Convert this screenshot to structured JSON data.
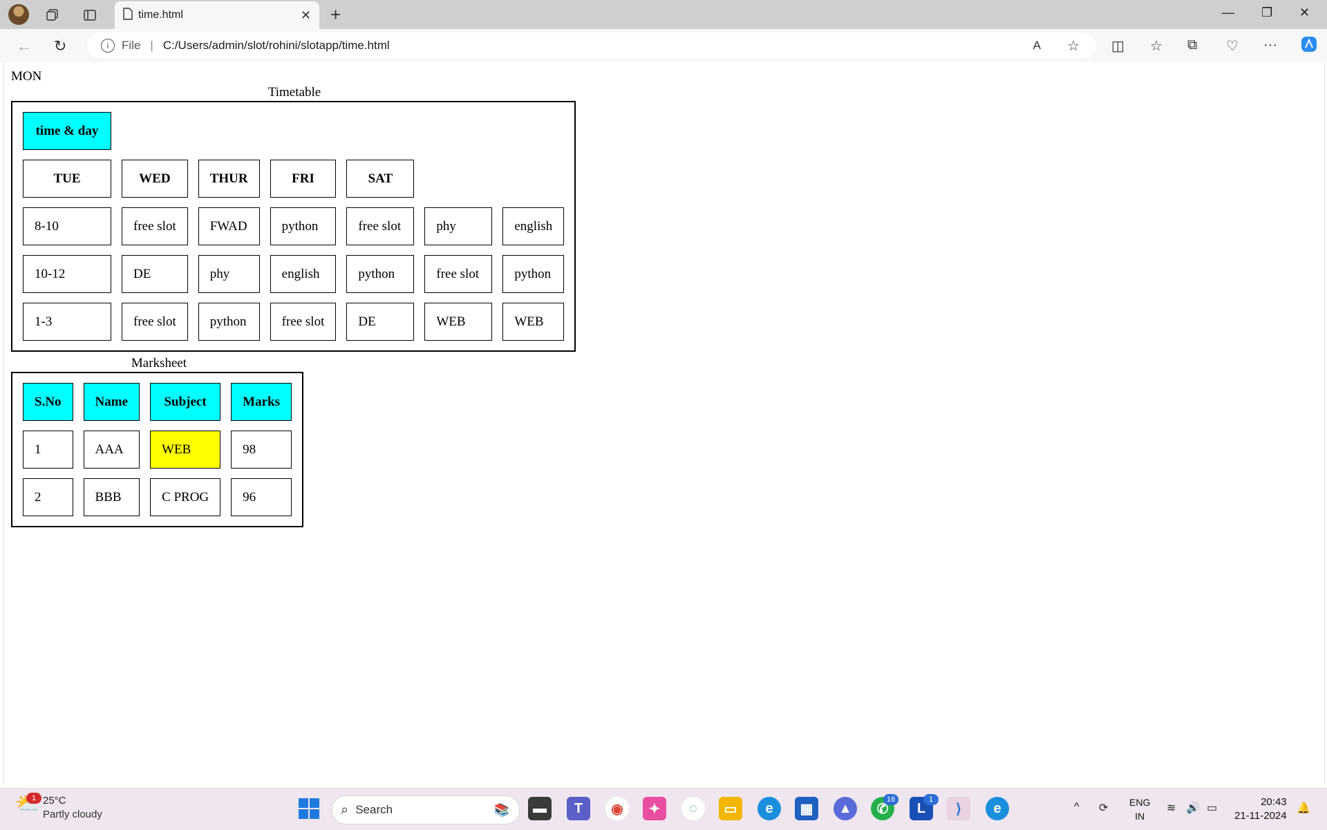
{
  "browser": {
    "tab_title": "time.html",
    "address_file_label": "File",
    "address_url": "C:/Users/admin/slot/rohini/slotapp/time.html"
  },
  "page": {
    "mon_label": "MON",
    "timetable": {
      "caption": "Timetable",
      "header_cell": "time & day",
      "day_headers": [
        "TUE",
        "WED",
        "THUR",
        "FRI",
        "SAT"
      ],
      "rows": [
        [
          "8-10",
          "free slot",
          "FWAD",
          "python",
          "free slot",
          "phy",
          "english"
        ],
        [
          "10-12",
          "DE",
          "phy",
          "english",
          "python",
          "free slot",
          "python"
        ],
        [
          "1-3",
          "free slot",
          "python",
          "free slot",
          "DE",
          "WEB",
          "WEB"
        ]
      ]
    },
    "marksheet": {
      "caption": "Marksheet",
      "headers": [
        "S.No",
        "Name",
        "Subject",
        "Marks"
      ],
      "rows": [
        [
          "1",
          "AAA",
          "WEB",
          "98"
        ],
        [
          "2",
          "BBB",
          "C PROG",
          "96"
        ]
      ]
    }
  },
  "taskbar": {
    "weather_temp": "25°C",
    "weather_condition": "Partly cloudy",
    "weather_badge": "1",
    "search_placeholder": "Search",
    "whatsapp_badge": "16",
    "lapp_badge": "1",
    "lang_line1": "ENG",
    "lang_line2": "IN",
    "time": "20:43",
    "date": "21-11-2024"
  },
  "colors": {
    "header_cyan": "#00ffff",
    "highlight_yellow": "#ffff00"
  }
}
